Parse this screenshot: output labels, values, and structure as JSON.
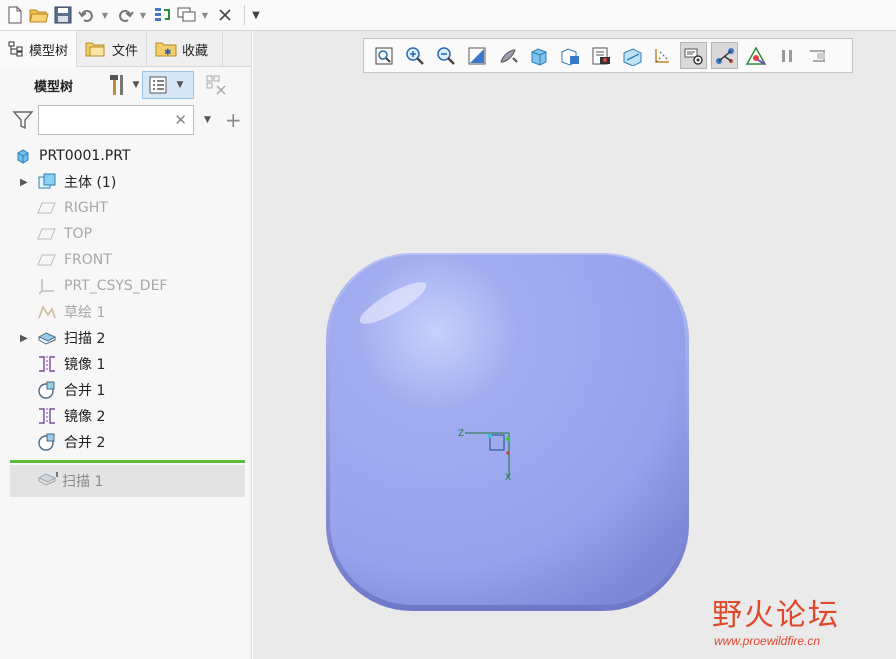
{
  "tabs": {
    "model_tree": "模型树",
    "files": "文件",
    "favorites": "收藏"
  },
  "model_tree": {
    "title": "模型树",
    "search_value": "",
    "items": [
      {
        "label": "PRT0001.PRT",
        "icon": "part-icon"
      },
      {
        "label": "主体 (1)",
        "icon": "body-icon"
      },
      {
        "label": "RIGHT",
        "icon": "datum-plane-icon"
      },
      {
        "label": "TOP",
        "icon": "datum-plane-icon"
      },
      {
        "label": "FRONT",
        "icon": "datum-plane-icon"
      },
      {
        "label": "PRT_CSYS_DEF",
        "icon": "csys-icon"
      },
      {
        "label": "草绘 1",
        "icon": "sketch-icon"
      },
      {
        "label": "扫描 2",
        "icon": "sweep-icon"
      },
      {
        "label": "镜像 1",
        "icon": "mirror-icon"
      },
      {
        "label": "合并 1",
        "icon": "merge-icon"
      },
      {
        "label": "镜像 2",
        "icon": "mirror-icon"
      },
      {
        "label": "合并 2",
        "icon": "merge-icon"
      }
    ],
    "suppressed_item": "扫描 1"
  },
  "watermark": {
    "text": "野火论坛",
    "url": "www.proewildfire.cn"
  },
  "colors": {
    "part_fill": "#9aa6ee",
    "insert_line": "#5cbc3e",
    "watermark": "#e0482c"
  }
}
